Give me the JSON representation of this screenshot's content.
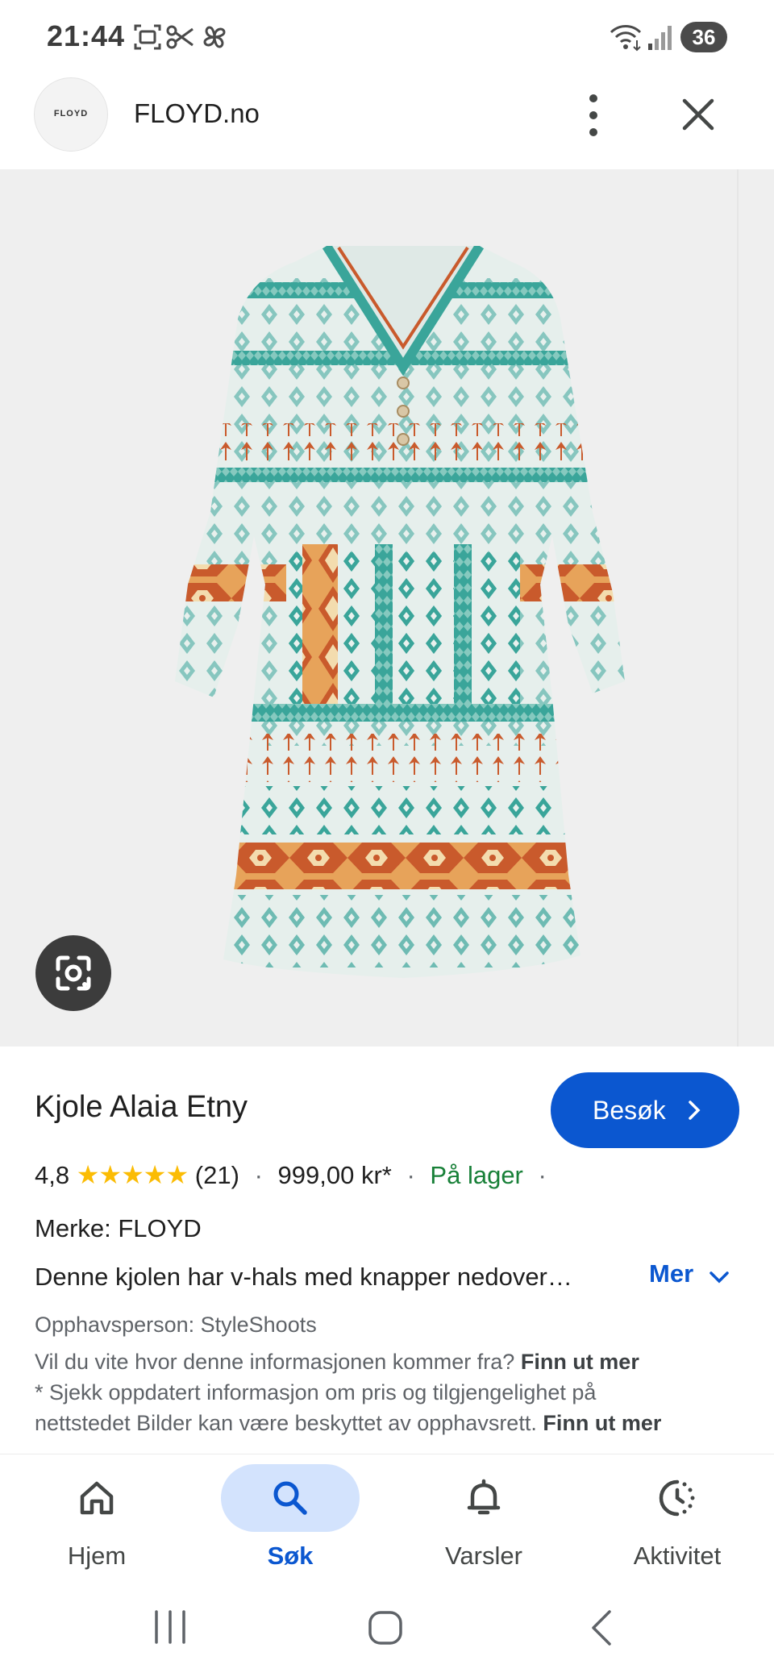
{
  "status_bar": {
    "time": "21:44",
    "battery": "36",
    "left_icons": [
      "screen-record-icon",
      "cut-icon",
      "pinwheel-icon"
    ],
    "right_icons": [
      "wifi-icon",
      "signal-icon"
    ]
  },
  "header": {
    "logo_text": "FLOYD",
    "site_name": "FLOYD.no"
  },
  "product": {
    "title": "Kjole Alaia Etny",
    "visit_label": "Besøk",
    "rating": "4,8",
    "stars": "★★★★★",
    "reviews": "(21)",
    "separator": "·",
    "price": "999,00 kr*",
    "stock": "På lager",
    "brand": "Merke: FLOYD",
    "description": "Denne kjolen har v-hals med knapper nedover…",
    "more_label": "Mer",
    "creator": "Opphavsperson: StyleShoots",
    "info_question": "Vil du vite hvor denne informasjonen kommer fra?",
    "learn_more": "Finn ut mer",
    "disclaimer_line1": "* Sjekk oppdatert informasjon om pris og tilgjengelighet på",
    "disclaimer_line2": "nettstedet Bilder kan være beskyttet av opphavsrett.",
    "learn_more_2": "Finn ut mer"
  },
  "bottom_nav": {
    "items": [
      {
        "label": "Hjem",
        "icon": "home-icon"
      },
      {
        "label": "Søk",
        "icon": "search-icon"
      },
      {
        "label": "Varsler",
        "icon": "bell-icon"
      },
      {
        "label": "Aktivitet",
        "icon": "activity-icon"
      }
    ],
    "active_index": 1
  },
  "colors": {
    "accent": "#0b57d0",
    "stock_green": "#188038",
    "star_yellow": "#fbbc04",
    "active_pill": "#d3e3fd"
  }
}
